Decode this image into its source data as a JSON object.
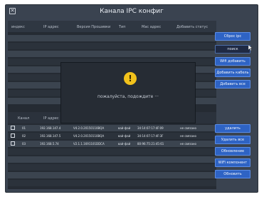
{
  "window": {
    "title": "Канала IPC конфиг"
  },
  "top_table": {
    "headers": [
      "индекс",
      "IP адрес",
      "Версия Прошивки",
      "Тип",
      "Mac адрес",
      "Добавить статус"
    ]
  },
  "side_buttons_top": [
    "Сброс ipc",
    "поиск",
    "Wifi добавить",
    "Добавить кабель",
    "Добавить все"
  ],
  "bottom_table": {
    "headers": [
      "Канал",
      "IP адрес"
    ],
    "rows": [
      [
        "01",
        "192.168.147.4",
        "V4.2.0.20150110BQA",
        "вай-фай",
        "34:14:07:17:4F:09",
        "не связано"
      ],
      [
        "02",
        "192.168.147.5",
        "V4.2.0.20150110BQA",
        "вай-фай",
        "34:14:07:17:4F:3F",
        "не связано"
      ],
      [
        "03",
        "192.168.5.74",
        "V2.1.1.1691101DDCA",
        "вай-фай",
        "80:96:75:21:45:61",
        "не связано"
      ]
    ]
  },
  "side_buttons_bottom": [
    "удалить",
    "Удалить все",
    "Обновление",
    "WiFi компонент",
    "Обновить"
  ],
  "modal": {
    "icon": "!",
    "message": "пожалуйста, подождите ···"
  }
}
